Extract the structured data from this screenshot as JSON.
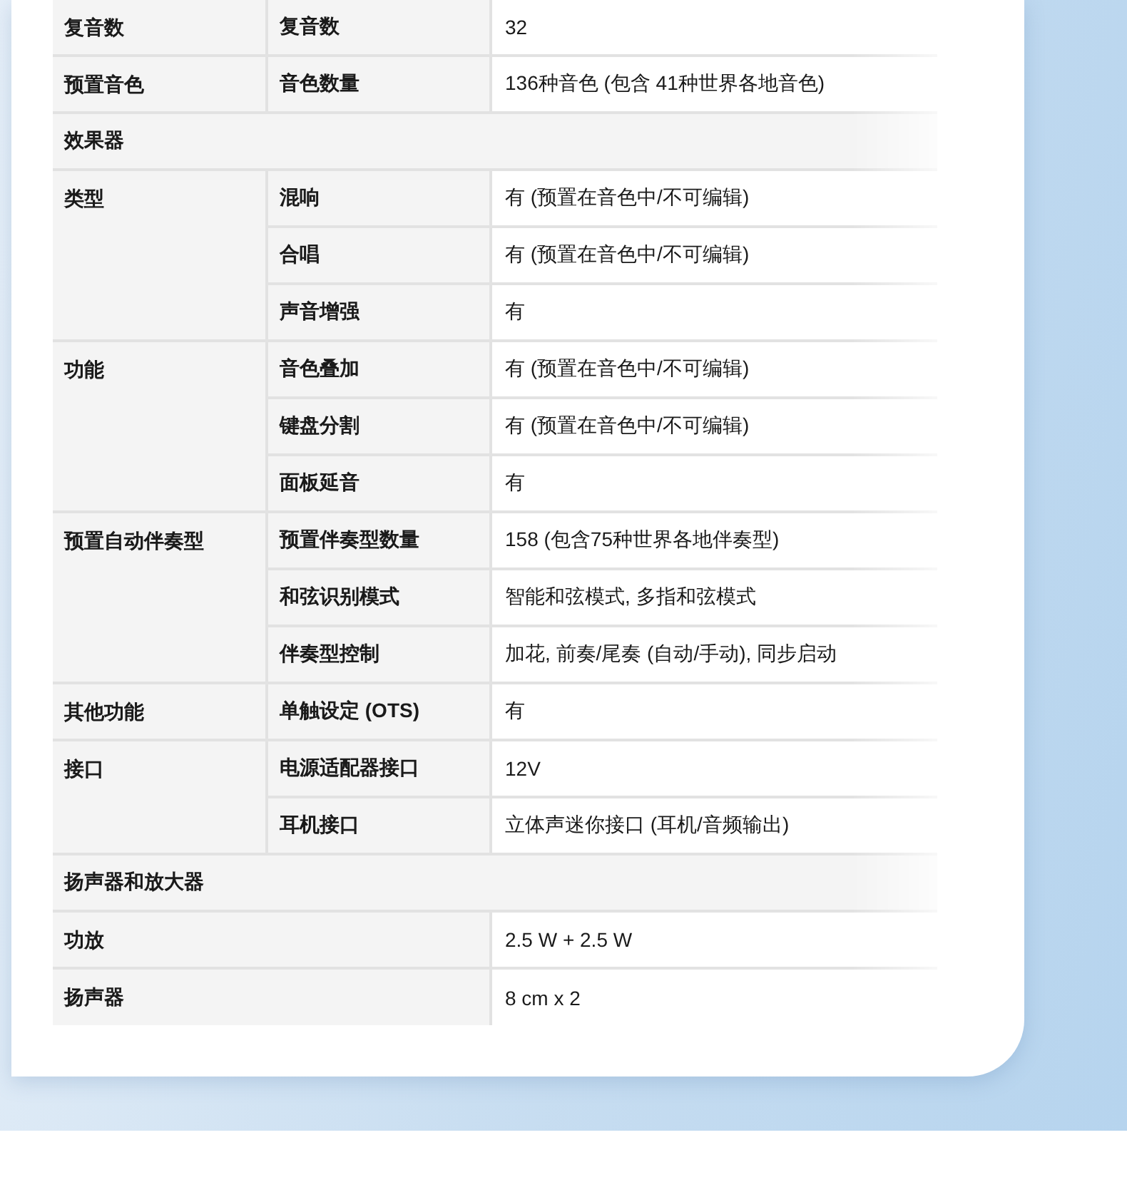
{
  "spec_table": {
    "groups": [
      {
        "kind": "group",
        "label": "复音数",
        "rows": [
          {
            "name": "复音数",
            "value": "32"
          }
        ]
      },
      {
        "kind": "group",
        "label": "预置音色",
        "rows": [
          {
            "name": "音色数量",
            "value": "136种音色 (包含 41种世界各地音色)"
          }
        ]
      },
      {
        "kind": "section",
        "label": "效果器"
      },
      {
        "kind": "group",
        "label": "类型",
        "rows": [
          {
            "name": "混响",
            "value": "有 (预置在音色中/不可编辑)"
          },
          {
            "name": "合唱",
            "value": "有 (预置在音色中/不可编辑)"
          },
          {
            "name": "声音增强",
            "value": "有"
          }
        ]
      },
      {
        "kind": "group",
        "label": "功能",
        "rows": [
          {
            "name": "音色叠加",
            "value": "有 (预置在音色中/不可编辑)"
          },
          {
            "name": "键盘分割",
            "value": "有 (预置在音色中/不可编辑)"
          },
          {
            "name": "面板延音",
            "value": "有"
          }
        ]
      },
      {
        "kind": "group",
        "label": "预置自动伴奏型",
        "rows": [
          {
            "name": "预置伴奏型数量",
            "value": "158 (包含75种世界各地伴奏型)"
          },
          {
            "name": "和弦识别模式",
            "value": "智能和弦模式, 多指和弦模式"
          },
          {
            "name": "伴奏型控制",
            "value": "加花, 前奏/尾奏 (自动/手动), 同步启动"
          }
        ]
      },
      {
        "kind": "group",
        "label": "其他功能",
        "rows": [
          {
            "name": "单触设定 (OTS)",
            "value": "有"
          }
        ]
      },
      {
        "kind": "group",
        "label": "接口",
        "rows": [
          {
            "name": "电源适配器接口",
            "value": "12V"
          },
          {
            "name": "耳机接口",
            "value": "立体声迷你接口 (耳机/音频输出)"
          }
        ]
      },
      {
        "kind": "section",
        "label": "扬声器和放大器"
      },
      {
        "kind": "pair",
        "label": "功放",
        "value": "2.5 W + 2.5 W"
      },
      {
        "kind": "pair",
        "label": "扬声器",
        "value": "8 cm x 2"
      }
    ]
  }
}
